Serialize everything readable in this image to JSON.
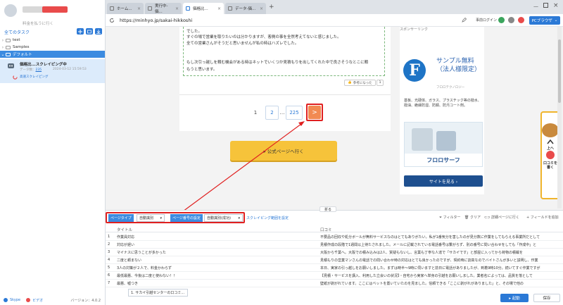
{
  "sidebar": {
    "subtitle": "料金を払うに行く",
    "tree_title": "全てのタスク",
    "items": [
      {
        "label": "test"
      },
      {
        "label": "Samples"
      },
      {
        "label": "デフォルト"
      }
    ],
    "task": {
      "title": "価格比...スクレイピング中",
      "meta_label": "データ数：",
      "meta_count": "235",
      "time": "2024-03-12 15:59:53",
      "status": "高速スクレイピング"
    },
    "footer": {
      "skype": "Skype",
      "video": "ビデオ",
      "version": "バージョン：4.0.2"
    }
  },
  "browser": {
    "tabs": [
      {
        "label": "ホーム..."
      },
      {
        "label": "実行中-価..."
      },
      {
        "label": "価格比..."
      },
      {
        "label": "データ-価..."
      }
    ],
    "new_tab": "+",
    "url": "https://minhyo.jp/sakai-hikkoshi",
    "login": "事前ログイン",
    "pc_browser": "PCブラウザ"
  },
  "page": {
    "review_lines": [
      "でした。",
      "すぐの場で営業を取りたいのは分かりますが、客側の事を全然考えてないと感じました。",
      "全ての営業さんがそうだと思いませんが私の時はハズレでした。",
      "もし次引っ越しを頼む機会がある時はネットでいくつか見積もりを出してくれた中で良さそうなとこに頼",
      "もうと思います。"
    ],
    "helpful_label": "参考になった",
    "helpful_count": "1",
    "pagination": {
      "first": "1",
      "second": "2",
      "ellipsis": "…",
      "last": "225",
      "next": ">"
    },
    "cta_label": "▸ 公式ページへ行く",
    "ad": {
      "header": "スポンサーリンク",
      "logo_letter": "F",
      "title": "サンプル無料（法人様限定）",
      "company": "フロロテクノロジー",
      "body": "基板、光硬体、ガラス、プラスチック等の撥水、撥油、絶縁防湿、防錆、防汚コート剤。",
      "banner": "フロロサーフ",
      "button": "サイトを見る ›"
    },
    "float": {
      "top": "上へ",
      "write": "口コミを書く"
    }
  },
  "panel": {
    "page_type_label": "ページタイプ",
    "page_type_value": "自動識別",
    "page_num_label": "ページ番号の設定",
    "page_num_value": "自動識別(成功)",
    "scrape_range": "スクレイピング範囲を設定",
    "tools": {
      "filter": "フィルター",
      "clear": "クリア",
      "detail": "詳細ページに行く",
      "add_field": "+ フィールドを追加"
    },
    "fold": "折る",
    "columns": [
      "タイトル",
      "口コミ"
    ],
    "rows": [
      {
        "n": "1",
        "title": "作業員対応",
        "body": "不要品の回収や処分ボールが無料サービスなのはとてもありがたい。私が1番気分を害したのが見分数に作業をしてもらえる事業所だとして"
      },
      {
        "n": "2",
        "title": "対応が遅い",
        "body": "見積作成の段階で1週間以上待たされました。メールに記載されている電話番号は繋がらず、別の番号に問い合わせをしても「作成中」と"
      },
      {
        "n": "3",
        "title": "マイナスに思うことが多かった",
        "body": "大阪から千葉へ。大阪での積み込みは2人、質疑もないし、言葉も丁寧な人達で「サカイです」と部屋に入ってから荷物の積載を"
      },
      {
        "n": "4",
        "title": "二度と頼まない",
        "body": "見積もりの営業マンさんの電話での問い合わせ時の対応はとても良かったのですが、契約時に割高なのでバイトさんが多いと説明し、作業"
      },
      {
        "n": "5",
        "title": "3人の対策が２人で、料金かわらず",
        "body": "本日、実家の引っ越しをお願いしました。まずは時半～9時に伺いますと前日に電話がありましたが、到着9時10分。続いてすぐ作業ですが"
      },
      {
        "n": "6",
        "title": "最低最悪、今後は二度と使わない！！",
        "body": "【見積・サービスを講入、利用した立会いの状況】・自宅から実家へ単身の引越をお願いしました。業者名によっては、品質を落として"
      },
      {
        "n": "7",
        "title": "最悪、嘘つき",
        "body": "壁紙が剥がれています。ここにはベットを置いていたのを見ました。信頼できる「ここに剥がれがありました」と、その場で他の"
      }
    ],
    "bottom_tab": "1. サカイ引越センターの口コミ...",
    "start": "▸ 起動",
    "save": "保存"
  }
}
